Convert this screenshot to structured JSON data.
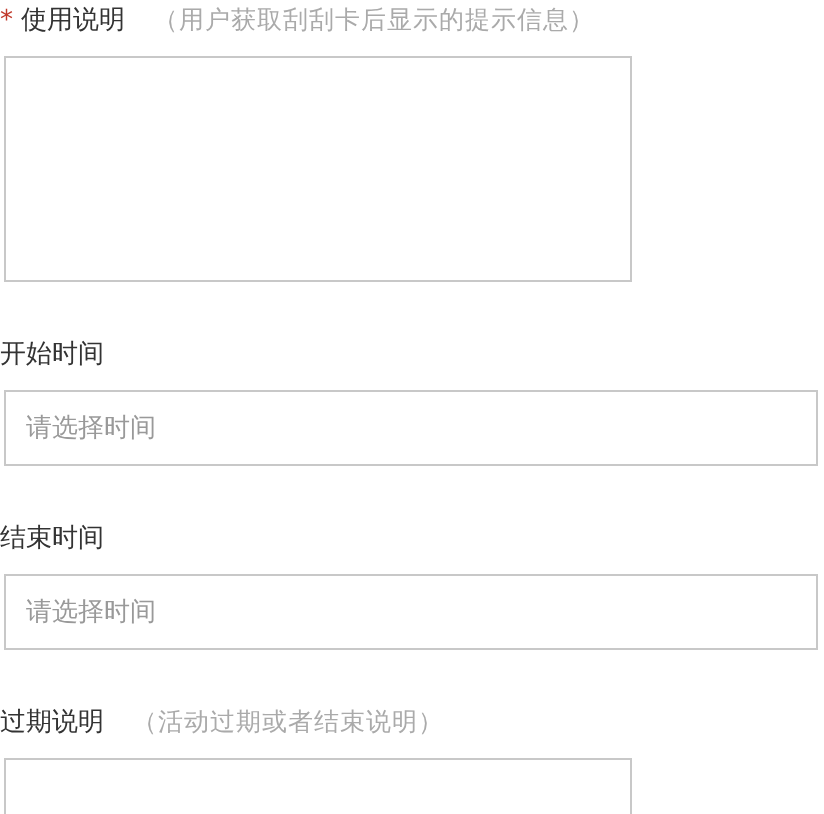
{
  "fields": [
    {
      "kind": "textarea",
      "required_mark": "*",
      "label": "使用说明",
      "hint": "（用户获取刮刮卡后显示的提示信息）"
    },
    {
      "kind": "input",
      "label": "开始时间",
      "placeholder": "请选择时间"
    },
    {
      "kind": "input",
      "label": "结束时间",
      "placeholder": "请选择时间"
    },
    {
      "kind": "textarea",
      "label": "过期说明",
      "hint": "（活动过期或者结束说明）"
    }
  ]
}
